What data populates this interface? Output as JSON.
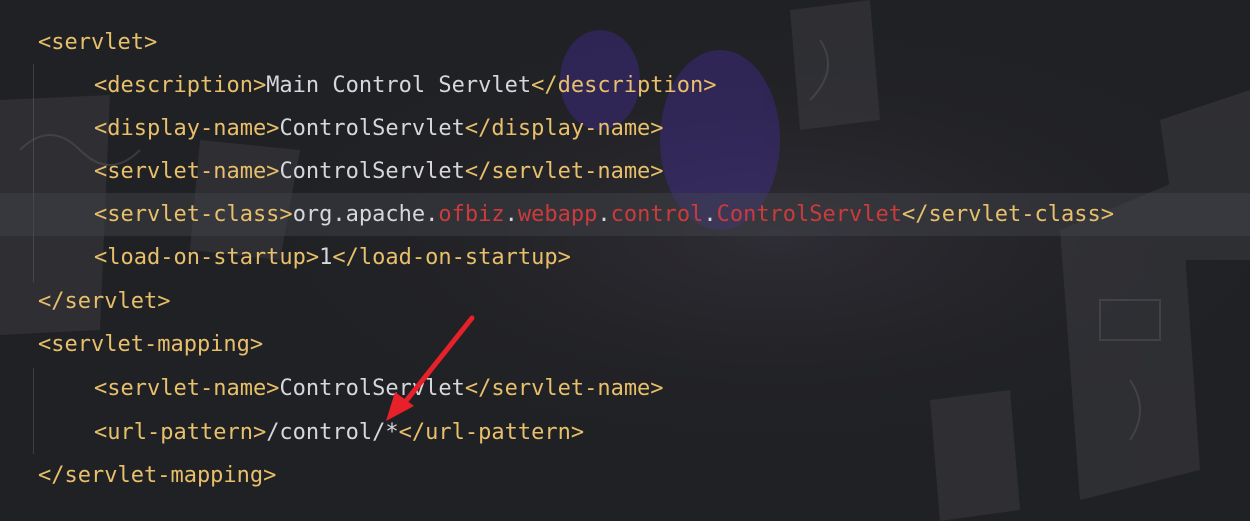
{
  "editor": {
    "lines": [
      {
        "parts": [
          {
            "t": "tag",
            "v": "<servlet>"
          }
        ]
      },
      {
        "parts": [
          {
            "t": "tag",
            "v": "<description>"
          },
          {
            "t": "txt",
            "v": "Main Control Servlet"
          },
          {
            "t": "tag",
            "v": "</description>"
          }
        ]
      },
      {
        "parts": [
          {
            "t": "tag",
            "v": "<display-name>"
          },
          {
            "t": "txt",
            "v": "ControlServlet"
          },
          {
            "t": "tag",
            "v": "</display-name>"
          }
        ]
      },
      {
        "parts": [
          {
            "t": "tag",
            "v": "<servlet-name>"
          },
          {
            "t": "txt",
            "v": "ControlServlet"
          },
          {
            "t": "tag",
            "v": "</servlet-name>"
          }
        ]
      },
      {
        "parts": [
          {
            "t": "tag",
            "v": "<servlet-class>"
          },
          {
            "t": "pkg",
            "v": "org.apache."
          },
          {
            "t": "pkg-hl",
            "v": "ofbiz"
          },
          {
            "t": "pkg",
            "v": "."
          },
          {
            "t": "pkg-hl",
            "v": "webapp"
          },
          {
            "t": "pkg",
            "v": "."
          },
          {
            "t": "pkg-hl",
            "v": "control"
          },
          {
            "t": "pkg",
            "v": "."
          },
          {
            "t": "pkg-hl",
            "v": "ControlServlet"
          },
          {
            "t": "tag",
            "v": "</servlet-class>"
          }
        ]
      },
      {
        "parts": [
          {
            "t": "tag",
            "v": "<load-on-startup>"
          },
          {
            "t": "txt",
            "v": "1"
          },
          {
            "t": "tag",
            "v": "</load-on-startup>"
          }
        ]
      },
      {
        "parts": [
          {
            "t": "tag",
            "v": "</servlet>"
          }
        ]
      },
      {
        "parts": [
          {
            "t": "tag",
            "v": "<servlet-mapping>"
          }
        ]
      },
      {
        "parts": [
          {
            "t": "tag",
            "v": "<servlet-name>"
          },
          {
            "t": "txt",
            "v": "ControlServlet"
          },
          {
            "t": "tag",
            "v": "</servlet-name>"
          }
        ]
      },
      {
        "parts": [
          {
            "t": "tag",
            "v": "<url-pattern>"
          },
          {
            "t": "txt",
            "v": "/control/*"
          },
          {
            "t": "tag",
            "v": "</url-pattern>"
          }
        ]
      },
      {
        "parts": [
          {
            "t": "tag",
            "v": "</servlet-mapping>"
          }
        ]
      }
    ]
  },
  "colors": {
    "tag": "#e8bf6a",
    "text": "#d5d7dc",
    "highlight": "#cc3b3b",
    "arrow": "#e8202a",
    "background": "#202124"
  },
  "annotation": {
    "icon": "red-arrow-icon"
  }
}
